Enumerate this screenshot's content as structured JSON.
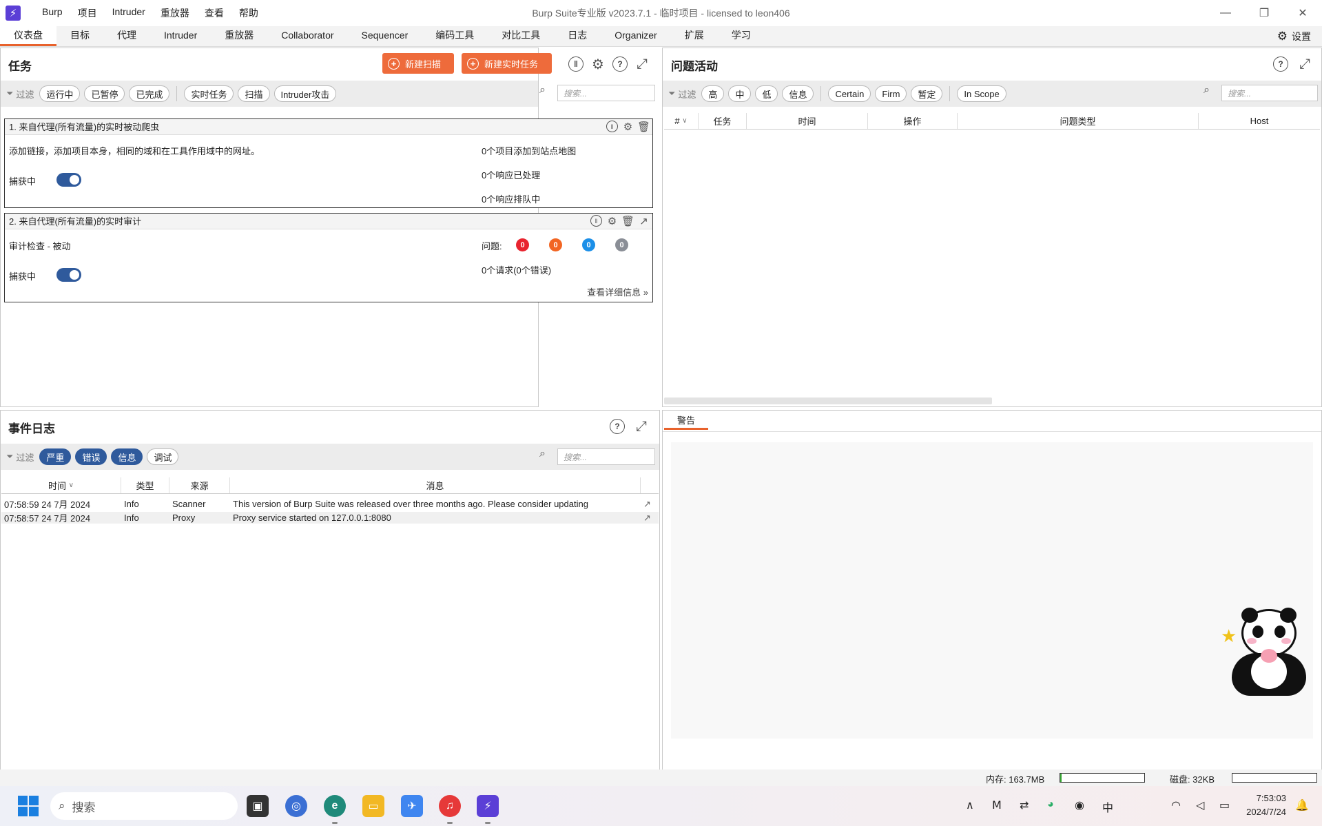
{
  "titlebar": {
    "logo": "⚡",
    "menu": [
      "Burp",
      "项目",
      "Intruder",
      "重放器",
      "查看",
      "帮助"
    ],
    "title": "Burp Suite专业版  v2023.7.1 - 临时项目 - licensed to leon406",
    "controls": [
      "minimize-icon",
      "restore-icon",
      "close-icon"
    ]
  },
  "tabs": [
    "仪表盘",
    "目标",
    "代理",
    "Intruder",
    "重放器",
    "Collaborator",
    "Sequencer",
    "编码工具",
    "对比工具",
    "日志",
    "Organizer",
    "扩展",
    "学习"
  ],
  "settings_label": "设置",
  "tasks_panel": {
    "title": "任务",
    "new_scan": "新建扫描",
    "new_live_task": "新建实时任务",
    "filter_label": "过滤",
    "filters_status": [
      "运行中",
      "已暂停",
      "已完成"
    ],
    "filters_type": [
      "实时任务",
      "扫描",
      "Intruder攻击"
    ],
    "search_placeholder": "搜索..."
  },
  "task1": {
    "title": "1. 来自代理(所有流量)的实时被动爬虫",
    "desc": "添加链接，添加项目本身，相同的域和在工具作用域中的网址。",
    "capture_label": "捕获中",
    "stat1": "0个项目添加到站点地图",
    "stat2": "0个响应已处理",
    "stat3": "0个响应排队中"
  },
  "task2": {
    "title": "2. 来自代理(所有流量)的实时审计",
    "desc": "审计检查 - 被动",
    "capture_label": "捕获中",
    "issues_label": "问题:",
    "issues": [
      {
        "count": "0",
        "color": "#e8242f"
      },
      {
        "count": "0",
        "color": "#f26522"
      },
      {
        "count": "0",
        "color": "#1b8fe8"
      },
      {
        "count": "0",
        "color": "#8a8e96"
      }
    ],
    "requests": "0个请求(0个错误)",
    "details_link": "查看详细信息"
  },
  "issues_panel": {
    "title": "问题活动",
    "filter_label": "过滤",
    "severity": [
      "高",
      "中",
      "低",
      "信息"
    ],
    "confidence": [
      "Certain",
      "Firm",
      "暂定"
    ],
    "scope": "In Scope",
    "search_placeholder": "搜索...",
    "columns": [
      "#",
      "任务",
      "时间",
      "操作",
      "问题类型",
      "Host"
    ]
  },
  "event_log": {
    "title": "事件日志",
    "filter_label": "过滤",
    "filters": [
      "严重",
      "错误",
      "信息",
      "调试"
    ],
    "search_placeholder": "搜索...",
    "columns": [
      "时间",
      "类型",
      "来源",
      "消息"
    ],
    "rows": [
      {
        "time": "07:58:59 24 7月 2024",
        "type": "Info",
        "source": "Scanner",
        "message": "This version of Burp Suite was released over three months ago. Please consider updating"
      },
      {
        "time": "07:58:57 24 7月 2024",
        "type": "Info",
        "source": "Proxy",
        "message": "Proxy service started on 127.0.0.1:8080"
      }
    ]
  },
  "advisory": {
    "tab": "警告"
  },
  "statusbar": {
    "memory": "内存: 163.7MB",
    "memory_fill": 0.02,
    "disk": "磁盘:  32KB",
    "disk_fill": 0.0
  },
  "taskbar": {
    "search": "搜索",
    "clock_time": "7:53:03",
    "clock_date": "2024/7/24",
    "tray_lang": "中"
  },
  "colors": {
    "accent_orange": "#ee6b3b",
    "toggle_blue": "#2f5a9c"
  }
}
